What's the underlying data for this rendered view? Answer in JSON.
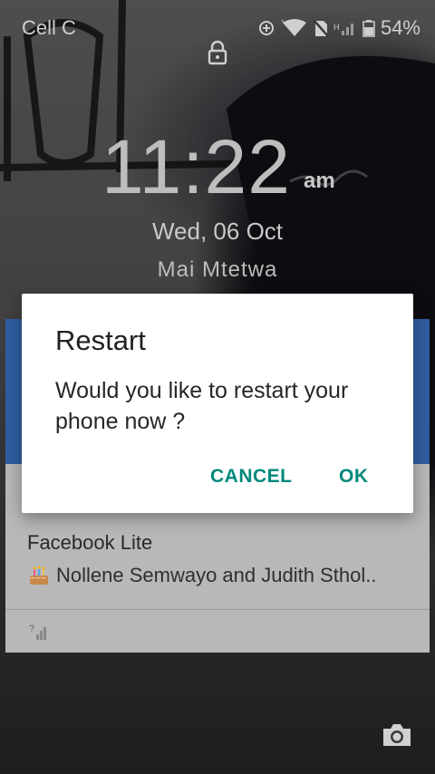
{
  "statusbar": {
    "carrier": "Cell C",
    "battery": "54%",
    "icons": [
      "data-saver-icon",
      "wifi-icon",
      "no-sim-icon",
      "signal-icon",
      "battery-icon"
    ]
  },
  "lockscreen": {
    "time": "11:22",
    "ampm": "am",
    "date": "Wed, 06 Oct",
    "owner": "Mai Mtetwa"
  },
  "notification": {
    "app": "Facebook Lite",
    "text": "Nollene Semwayo and Judith Sthol..",
    "icon": "birthday-cake-icon"
  },
  "dialog": {
    "title": "Restart",
    "message": "Would you like to restart your phone now ?",
    "cancel_label": "CANCEL",
    "ok_label": "OK"
  },
  "colors": {
    "accent": "#00897b",
    "notification_blue": "#2f5ea1"
  }
}
